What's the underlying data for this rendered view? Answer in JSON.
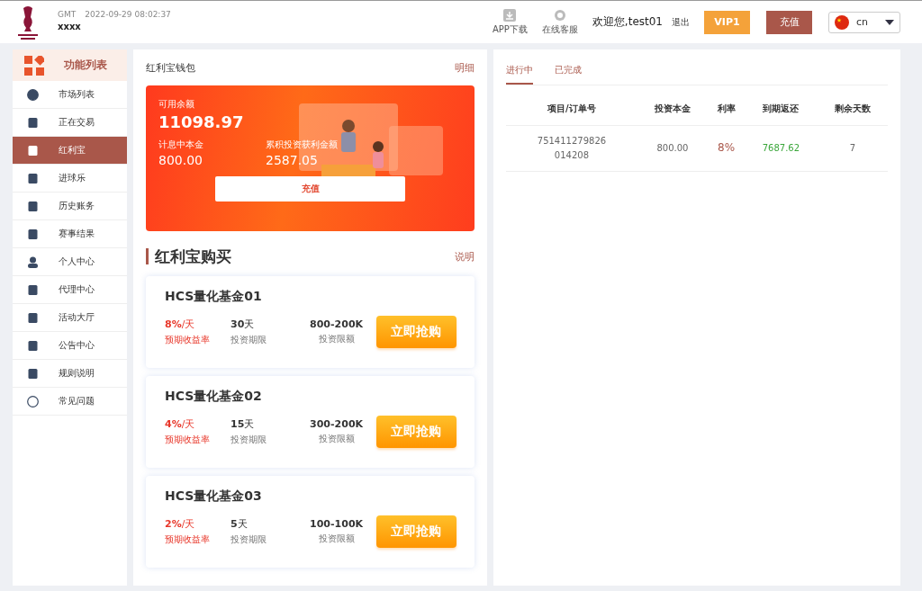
{
  "header": {
    "timezone": "GMT",
    "datetime": "2022-09-29 08:02:37",
    "username": "xxxx",
    "app_download": "APP下载",
    "online_service": "在线客服",
    "welcome": "欢迎您,test01",
    "logout": "退出",
    "vip": "VIP1",
    "recharge": "充值",
    "language": "cn"
  },
  "sidebar": {
    "title": "功能列表",
    "items": [
      {
        "label": "市场列表",
        "selected": false
      },
      {
        "label": "正在交易",
        "selected": false
      },
      {
        "label": "红利宝",
        "selected": true
      },
      {
        "label": "进球乐",
        "selected": false
      },
      {
        "label": "历史账务",
        "selected": false
      },
      {
        "label": "赛事结果",
        "selected": false
      },
      {
        "label": "个人中心",
        "selected": false
      },
      {
        "label": "代理中心",
        "selected": false
      },
      {
        "label": "活动大厅",
        "selected": false
      },
      {
        "label": "公告中心",
        "selected": false
      },
      {
        "label": "规则说明",
        "selected": false
      },
      {
        "label": "常见问题",
        "selected": false
      }
    ]
  },
  "wallet": {
    "title": "红利宝钱包",
    "details_link": "明细",
    "balance_label": "可用余额",
    "balance": "11098.97",
    "principal_label": "计息中本金",
    "principal": "800.00",
    "earnings_label": "累积投资获利金额",
    "earnings": "2587.05",
    "recharge_button": "充值"
  },
  "purchase": {
    "title": "红利宝购买",
    "info_link": "说明",
    "products": [
      {
        "name": "HCS量化基金01",
        "rate": "8%",
        "rate_unit": "/天",
        "rate_label": "预期收益率",
        "term": "30",
        "term_unit": "天",
        "term_label": "投资期限",
        "limit": "800-200K",
        "limit_label": "投资限额",
        "button": "立即抢购"
      },
      {
        "name": "HCS量化基金02",
        "rate": "4%",
        "rate_unit": "/天",
        "rate_label": "预期收益率",
        "term": "15",
        "term_unit": "天",
        "term_label": "投资期限",
        "limit": "300-200K",
        "limit_label": "投资限额",
        "button": "立即抢购"
      },
      {
        "name": "HCS量化基金03",
        "rate": "2%",
        "rate_unit": "/天",
        "rate_label": "预期收益率",
        "term": "5",
        "term_unit": "天",
        "term_label": "投资期限",
        "limit": "100-100K",
        "limit_label": "投资限额",
        "button": "立即抢购"
      }
    ]
  },
  "orders": {
    "tabs": [
      {
        "label": "进行中",
        "selected": true
      },
      {
        "label": "已完成",
        "selected": false
      }
    ],
    "table": {
      "columns": [
        "项目/订单号",
        "投资本金",
        "利率",
        "到期返还",
        "剩余天数"
      ],
      "rows": [
        [
          "751411279826\n014208",
          "800.00",
          "8%",
          "7687.62",
          "7"
        ]
      ]
    }
  }
}
